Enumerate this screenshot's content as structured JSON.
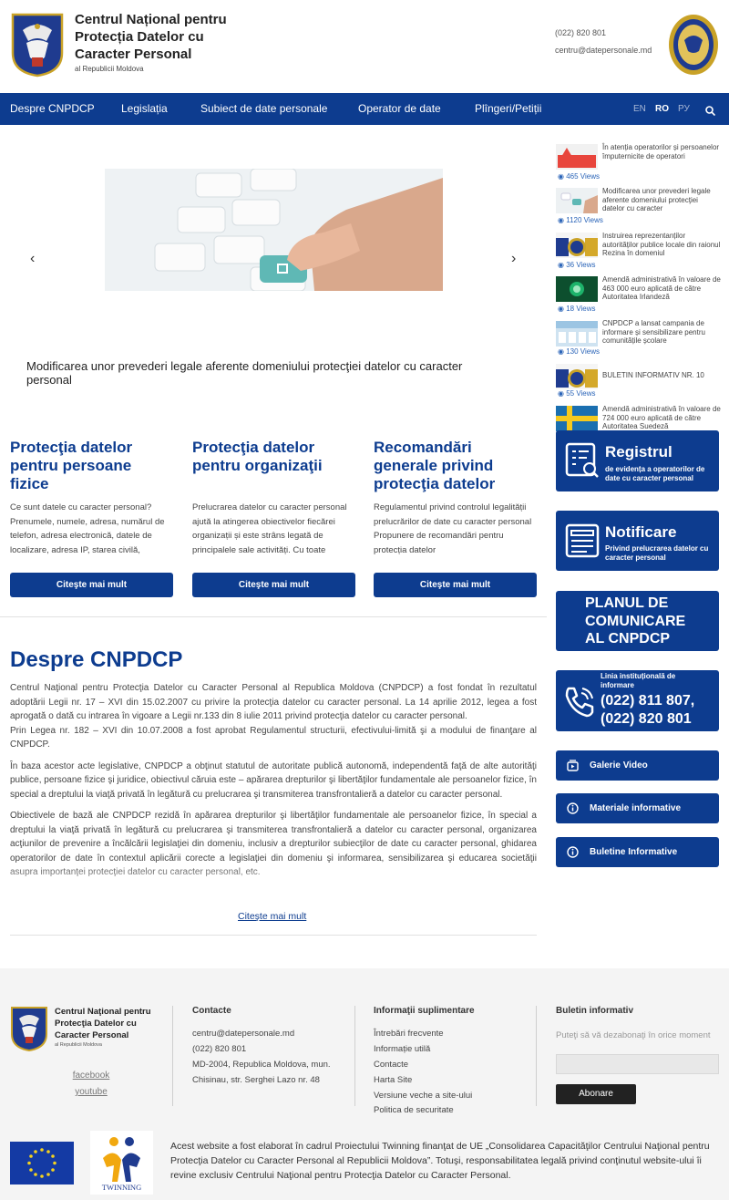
{
  "header": {
    "org_name": "Centrul Național pentru Protecția Datelor cu Caracter Personal",
    "org_sub": "al Republicii Moldova",
    "phone": "(022) 820 801",
    "email": "centru@datepersonale.md"
  },
  "nav": {
    "items": [
      "Despre CNPDCP",
      "Legislația",
      "Subiect de date personale",
      "Operator de date",
      "Plîngeri/Petiții"
    ],
    "languages": [
      "EN",
      "RO",
      "РУ"
    ],
    "active_language": "RO"
  },
  "slider": {
    "caption": "Modificarea unor prevederi legale aferente domeniului protecţiei datelor cu caracter personal",
    "prev": "‹",
    "next": "›"
  },
  "news": [
    {
      "title": "În atenția operatorilor și persoanelor împuternicite de operatori",
      "views": "465 Views"
    },
    {
      "title": "Modificarea unor prevederi legale aferente domeniului protecţiei datelor cu caracter",
      "views": "1120 Views"
    },
    {
      "title": "Instruirea reprezentanților autorităților publice locale din raionul Rezina în domeniul",
      "views": "36 Views"
    },
    {
      "title": "Amendă administrativă în valoare de 463 000 euro aplicată de către Autoritatea Irlandeză",
      "views": "18 Views"
    },
    {
      "title": "CNPDCP a lansat campania de informare și sensibilizare pentru comunitățile școlare",
      "views": "130 Views"
    },
    {
      "title": "BULETIN INFORMATIV NR. 10",
      "views": "55 Views"
    },
    {
      "title": "Amendă administrativă în valoare de 724 000 euro aplicată de către Autoritatea Suedeză",
      "views": ""
    }
  ],
  "cards": [
    {
      "title": "Protecţia datelor pentru persoane fizice",
      "text": "Ce sunt datele cu caracter personal? Prenumele, numele, adresa, numărul de telefon, adresa electronică, datele de localizare, adresa IP, starea civilă,",
      "button": "Citeşte mai mult"
    },
    {
      "title": "Protecţia datelor pentru organizaţii",
      "text": "Prelucrarea datelor cu caracter personal ajută la atingerea obiectivelor fiecărei organizații și este strâns legată de principalele sale activități. Cu toate",
      "button": "Citeşte mai mult"
    },
    {
      "title": "Recomandări generale privind protecţia datelor",
      "text": "Regulamentul privind controlul legalității prelucrărilor de date cu caracter personal Propunere de recomandări pentru protecția datelor",
      "button": "Citeşte mai mult"
    }
  ],
  "despre": {
    "title": "Despre CNPDCP",
    "p1": "Centrul Naţional pentru Protecţia Datelor cu Caracter Personal al Republica Moldova (CNPDCP) a fost fondat în rezultatul adoptării Legii nr. 17 – XVI din 15.02.2007 cu privire la protecţia datelor cu caracter personal. La 14 aprilie 2012, legea a fost aprogată o dată cu intrarea în vigoare a Legii nr.133 din 8 iulie 2011 privind protecţia datelor cu caracter personal.",
    "p1b": "Prin Legea nr. 182 – XVI din 10.07.2008 a fost aprobat Regulamentul structurii, efectivului-limită şi a modului de finanţare al CNPDCP.",
    "p2": "În baza acestor acte legislative, CNPDCP a obţinut statutul de autoritate publică autonomă, independentă faţă de alte autorităţi publice, persoane fizice şi juridice, obiectivul căruia este – apărarea drepturilor şi libertăţilor fundamentale ale persoanelor fizice, în special a dreptului la viaţă privată în legătură cu prelucrarea şi transmiterea transfrontalieră a datelor cu caracter personal.",
    "p3": "Obiectivele de bază ale CNPDCP rezidă în apărarea drepturilor şi libertăţilor fundamentale ale persoanelor fizice, în special a dreptului la viaţă privată în legătură cu prelucrarea şi transmiterea transfrontalieră a datelor cu caracter personal, organizarea acţiunilor de prevenire a încălcării legislaţiei din domeniu, inclusiv a drepturilor subiecţilor de date cu caracter personal, ghidarea operatorilor de date în contextul aplicării corecte a legislaţiei din domeniu şi informarea, sensibilizarea şi educarea societăţii asupra importanţei protecţiei datelor cu caracter personal, etc.",
    "read_more": "Citeşte mai mult"
  },
  "widgets": {
    "registru_title": "Registrul",
    "registru_sub": "de evidența a operatorilor de date cu caracter personal",
    "notificare_title": "Notificare",
    "notificare_sub": "Privind prelucrarea datelor cu caracter personal",
    "planul": "PLANUL DE COMUNICARE AL CNPDCP",
    "linia_label": "Linia instituțională de informare",
    "linia_phones": "(022) 811 807, (022) 820 801",
    "galerie": "Galerie Video",
    "materiale": "Materiale informative",
    "buletine": "Buletine Informative"
  },
  "footer": {
    "org_name": "Centrul Naţional pentru Protecţia Datelor cu Caracter Personal",
    "org_sub": "al Republicii Moldova",
    "facebook": "facebook",
    "youtube": "youtube",
    "contacte_head": "Contacte",
    "email": "centru@datepersonale.md",
    "phone": "(022) 820 801",
    "address1": "MD-2004, Republica Moldova, mun.",
    "address2": "Chisinau, str. Serghei Lazo nr. 48",
    "info_head": "Informaţii suplimentare",
    "info_links": [
      "Întrebări frecvente",
      "Informație utilă",
      "Contacte",
      "Harta Site",
      "Versiune veche a site-ului",
      "Politica de securitate"
    ],
    "buletin_head": "Buletin informativ",
    "buletin_placeholder": "Puteţi să vă dezabonaţi în orice moment",
    "abonare": "Abonare",
    "twinning": "TWINNING",
    "disclaimer": "Acest website a fost elaborat în cadrul Proiectului Twinning finanţat de UE „Consolidarea Capacităţilor Centrului Naţional pentru Protecţia Datelor cu Caracter Personal al Republicii Moldova”. Totuşi, responsabilitatea legală privind conţinutul website-ului îi revine exclusiv Centrului Naţional pentru Protecţia Datelor cu Caracter Personal."
  },
  "colors": {
    "brand": "#0d3c8f",
    "footer_bg": "#f4f4f4"
  }
}
